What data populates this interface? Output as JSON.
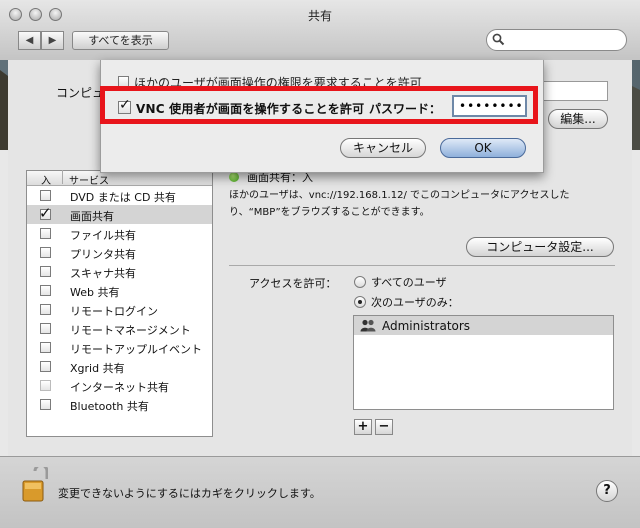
{
  "window": {
    "title": "共有"
  },
  "toolbar": {
    "back_label": "◀",
    "forward_label": "▶",
    "show_all_label": "すべてを表示",
    "search_placeholder": ""
  },
  "computer": {
    "label": "コンピュ",
    "edit_label": "編集..."
  },
  "sheet": {
    "opt1_label": "ほかのユーザが画面操作の権限を要求することを許可",
    "vnc_label": "VNC 使用者が画面を操作することを許可",
    "password_label": "パスワード：",
    "password_value": "••••••••",
    "cancel_label": "キャンセル",
    "ok_label": "OK"
  },
  "services": {
    "header_on": "入",
    "header_service": "サービス",
    "items": [
      {
        "label": "DVD または CD 共有",
        "checked": false
      },
      {
        "label": "画面共有",
        "checked": true
      },
      {
        "label": "ファイル共有",
        "checked": false
      },
      {
        "label": "プリンタ共有",
        "checked": false
      },
      {
        "label": "スキャナ共有",
        "checked": false
      },
      {
        "label": "Web 共有",
        "checked": false
      },
      {
        "label": "リモートログイン",
        "checked": false
      },
      {
        "label": "リモートマネージメント",
        "checked": false
      },
      {
        "label": "リモートアップルイベント",
        "checked": false
      },
      {
        "label": "Xgrid 共有",
        "checked": false
      },
      {
        "label": "インターネット共有",
        "checked": false
      },
      {
        "label": "Bluetooth 共有",
        "checked": false
      }
    ]
  },
  "detail": {
    "status": "画面共有：入",
    "desc_line1": "ほかのユーザは、vnc://192.168.1.12/ でこのコンピュータにアクセスした",
    "desc_line2": "り、“MBP”をブラウズすることができます。",
    "computer_settings_label": "コンピュータ設定...",
    "access_label": "アクセスを許可：",
    "radio_all": "すべてのユーザ",
    "radio_only": "次のユーザのみ：",
    "users": [
      "Administrators"
    ],
    "add_label": "+",
    "remove_label": "−"
  },
  "footer": {
    "lock_text": "変更できないようにするにはカギをクリックします。",
    "help_label": "?"
  },
  "colors": {
    "highlight": "#e8151b",
    "selected_row": "#d4d4d4",
    "status_green": "#3f9e1b"
  }
}
